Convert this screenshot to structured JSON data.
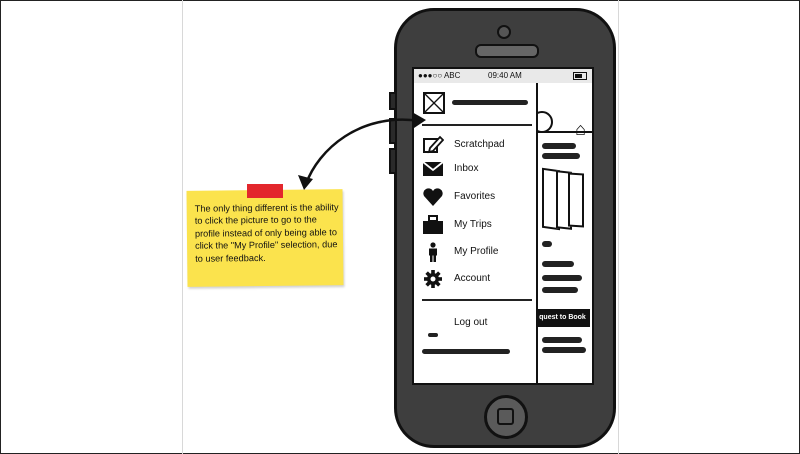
{
  "status_bar": {
    "carrier": "●●●○○ ABC",
    "time": "09:40 AM"
  },
  "background_screen": {
    "request_button_label": "quest to Book"
  },
  "drawer": {
    "menu_items": [
      {
        "label": "Scratchpad",
        "icon": "pencil-edit-icon"
      },
      {
        "label": "Inbox",
        "icon": "envelope-icon"
      },
      {
        "label": "Favorites",
        "icon": "heart-icon"
      },
      {
        "label": "My Trips",
        "icon": "suitcase-icon"
      },
      {
        "label": "My Profile",
        "icon": "person-icon"
      },
      {
        "label": "Account",
        "icon": "gear-icon"
      }
    ],
    "logout_label": "Log out"
  },
  "sticky_note": {
    "text": "The only thing different is the ability to click the picture to go to the profile instead of only being able to click the \"My Profile\" selection, due to user feedback.",
    "color": "#fbe34d",
    "tape_color": "#e3272c"
  }
}
